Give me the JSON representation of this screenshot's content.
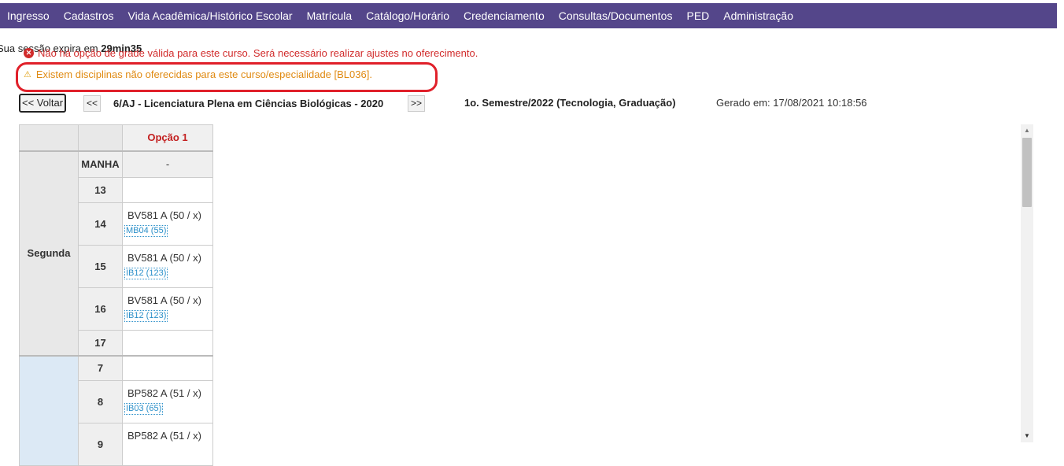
{
  "nav": {
    "items": [
      "Ingresso",
      "Cadastros",
      "Vida Acadêmica/Histórico Escolar",
      "Matrícula",
      "Catálogo/Horário",
      "Credenciamento",
      "Consultas/Documentos",
      "PED",
      "Administração"
    ]
  },
  "session": {
    "prefix": "Sua sessão expira em ",
    "time": "29min35"
  },
  "messages": {
    "error": "Não há opção de grade válida para este curso. Será necessário realizar ajustes no oferecimento.",
    "warning": "Existem disciplinas não oferecidas para este curso/especialidade [BL036]."
  },
  "toolbar": {
    "back_label": "<< Voltar",
    "prev_label": "<<",
    "next_label": ">>",
    "course": "6/AJ - Licenciatura Plena em Ciências Biológicas - 2020",
    "semester": "1o. Semestre/2022 (Tecnologia, Graduação)",
    "generated": "Gerado em: 17/08/2021 10:18:56"
  },
  "grid": {
    "header_option": "Opção 1",
    "shift_label": "MANHA",
    "shift_value": "-",
    "day1": "Segunda",
    "rows": [
      {
        "hour": "13",
        "course": "",
        "room": ""
      },
      {
        "hour": "14",
        "course": "BV581 A (50 / x)",
        "room": "MB04 (55)"
      },
      {
        "hour": "15",
        "course": "BV581 A (50 / x)",
        "room": "IB12 (123)"
      },
      {
        "hour": "16",
        "course": "BV581 A (50 / x)",
        "room": "IB12 (123)"
      },
      {
        "hour": "17",
        "course": "",
        "room": ""
      },
      {
        "hour": "7",
        "course": "",
        "room": ""
      },
      {
        "hour": "8",
        "course": "BP582 A (51 / x)",
        "room": "IB03 (65)"
      },
      {
        "hour": "9",
        "course": "BP582 A (51 / x)",
        "room": ""
      }
    ]
  },
  "colors": {
    "navbar": "#54468a",
    "error": "#d12b2b",
    "warning": "#e08a12",
    "option_header": "#c32020",
    "room_link": "#2a8fc9"
  }
}
